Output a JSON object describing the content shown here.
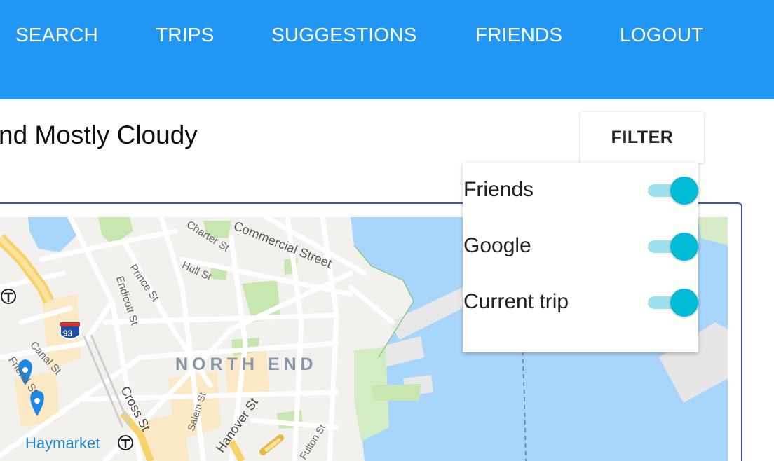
{
  "nav": {
    "items": [
      {
        "label": "SEARCH"
      },
      {
        "label": "TRIPS"
      },
      {
        "label": "SUGGESTIONS"
      },
      {
        "label": "FRIENDS"
      },
      {
        "label": "LOGOUT"
      }
    ]
  },
  "weather": {
    "text": "nd Mostly Cloudy"
  },
  "filter": {
    "button_label": "FILTER",
    "options": [
      {
        "label": "Friends",
        "enabled": true
      },
      {
        "label": "Google",
        "enabled": true
      },
      {
        "label": "Current trip",
        "enabled": true
      }
    ]
  },
  "map": {
    "labels": {
      "commercial_street": "Commercial Street",
      "charter_st": "Charter St",
      "hull_st": "Hull St",
      "prince_st": "Prince St",
      "endicott_st": "Endicott St",
      "canal_st": "Canal St",
      "friend_st": "Friend St",
      "north_end": "NORTH END",
      "cross_st": "Cross St",
      "salem_st": "Salem St",
      "hanover_st": "Hanover St",
      "fulton_st": "Fulton St",
      "haymarket": "Haymarket",
      "interstate": "93"
    }
  },
  "colors": {
    "nav_background": "#2196f3",
    "toggle_on": "#00bcd4",
    "water": "#a8d5fb",
    "park": "#c8e6b0",
    "map_frame": "#3f51b5"
  }
}
